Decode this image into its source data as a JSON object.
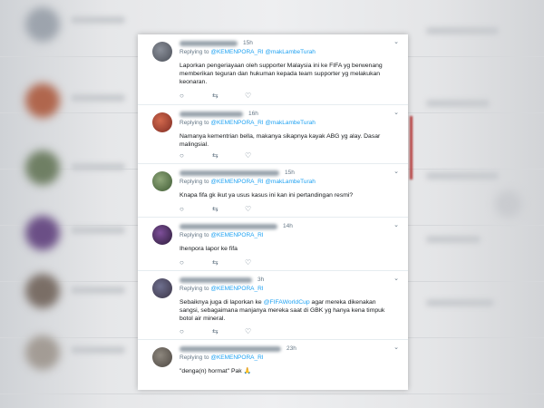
{
  "tweets": [
    {
      "time": "15h",
      "replying_label": "Replying to",
      "mentions": "@KEMENPORA_RI @makLambeTurah",
      "text": "Laporkan pengeriayaan oleh supporter Malaysia ini ke FIFA yg berwenang memberikan teguran dan hukuman kepada team supporter yg melakukan keonaran."
    },
    {
      "time": "16h",
      "replying_label": "Replying to",
      "mentions": "@KEMENPORA_RI @makLambeTurah",
      "text": "Namanya kementrian bella, makanya sikapnya kayak ABG yg alay. Dasar malingsial."
    },
    {
      "time": "15h",
      "replying_label": "Replying to",
      "mentions": "@KEMENPORA_RI @makLambeTurah",
      "text": "Knapa fifa gk ikut ya usus kasus ini kan ini pertandingan resmi?"
    },
    {
      "time": "14h",
      "replying_label": "Replying to",
      "mentions": "@KEMENPORA_RI",
      "text": "Ihenpora lapor ke fifa"
    },
    {
      "time": "3h",
      "replying_label": "Replying to",
      "mentions": "@KEMENPORA_RI",
      "text_before": "Sebaiknya juga di laporkan ke ",
      "text_mention": "@FIFAWorldCup",
      "text_after": " agar mereka dikenakan sangsi, sebagaimana manjanya mereka saat di GBK yg hanya kena timpuk botol air mineral."
    },
    {
      "time": "23h",
      "replying_label": "Replying to",
      "mentions": "@KEMENPORA_RI",
      "text": "\"denga(n) hormat\" Pak 🙏"
    }
  ],
  "icons": {
    "reply": "reply-icon",
    "retweet": "retweet-icon",
    "like": "heart-icon",
    "more": "chevron-down-icon"
  },
  "colors": {
    "link": "#1da1f2",
    "meta": "#657786",
    "text": "#14171a"
  }
}
